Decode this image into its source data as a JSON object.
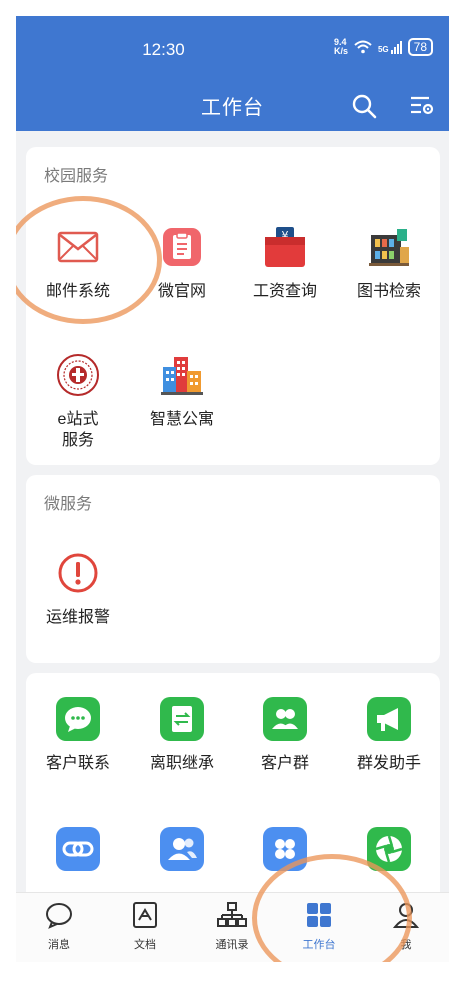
{
  "status": {
    "time": "12:30",
    "speed_top": "9.4",
    "speed_bottom": "K/s",
    "network": "5G",
    "battery": "78"
  },
  "header": {
    "title": "工作台",
    "search_icon": "search-icon",
    "settings_icon": "list-settings-icon"
  },
  "campus": {
    "title": "校园服务",
    "items": [
      {
        "label": "邮件系统",
        "icon": "mail-icon"
      },
      {
        "label": "微官网",
        "icon": "clipboard-icon"
      },
      {
        "label": "工资查询",
        "icon": "wallet-yen-icon"
      },
      {
        "label": "图书检索",
        "icon": "library-icon"
      },
      {
        "label": "e站式服务",
        "icon": "seal-logo-icon"
      },
      {
        "label": "智慧公寓",
        "icon": "buildings-icon"
      }
    ]
  },
  "micro": {
    "title": "微服务",
    "items": [
      {
        "label": "运维报警",
        "icon": "alert-circle-icon"
      }
    ]
  },
  "tools": {
    "items": [
      {
        "label": "客户联系",
        "icon": "chat-bubble-icon"
      },
      {
        "label": "离职继承",
        "icon": "transfer-doc-icon"
      },
      {
        "label": "客户群",
        "icon": "group-icon"
      },
      {
        "label": "群发助手",
        "icon": "megaphone-icon"
      },
      {
        "label": "",
        "icon": "link-icon"
      },
      {
        "label": "",
        "icon": "contacts-icon"
      },
      {
        "label": "",
        "icon": "apps-icon"
      },
      {
        "label": "",
        "icon": "aperture-icon"
      }
    ]
  },
  "tabbar": {
    "items": [
      {
        "label": "消息",
        "icon": "message-icon"
      },
      {
        "label": "文档",
        "icon": "document-icon"
      },
      {
        "label": "通讯录",
        "icon": "org-chart-icon"
      },
      {
        "label": "工作台",
        "icon": "workbench-grid-icon",
        "active": true
      },
      {
        "label": "我",
        "icon": "profile-icon"
      }
    ],
    "active_color": "#3f77d0"
  },
  "colors": {
    "header": "#3f77d0",
    "annotation": "#ec965a"
  }
}
